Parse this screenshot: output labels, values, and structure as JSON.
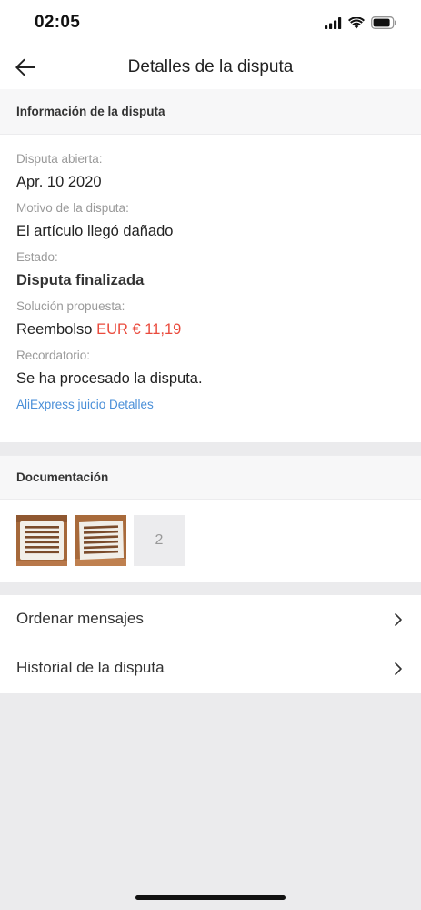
{
  "status": {
    "time": "02:05"
  },
  "header": {
    "title": "Detalles de la disputa"
  },
  "info": {
    "section_title": "Información de la disputa",
    "opened_label": "Disputa abierta:",
    "opened_value": "Apr. 10 2020",
    "reason_label": "Motivo de la disputa:",
    "reason_value": "El artículo llegó dañado",
    "state_label": "Estado:",
    "state_value": "Disputa finalizada",
    "solution_label": "Solución propuesta:",
    "solution_type": "Reembolso",
    "solution_amount": "EUR € 11,19",
    "reminder_label": "Recordatorio:",
    "reminder_value": "Se ha procesado la disputa.",
    "details_link": "AliExpress juicio Detalles"
  },
  "documentation": {
    "section_title": "Documentación",
    "more_count": "2"
  },
  "menu": {
    "items": [
      {
        "label": "Ordenar mensajes"
      },
      {
        "label": "Historial de la disputa"
      }
    ]
  },
  "colors": {
    "accent_price": "#ea4a3c",
    "link": "#4a8fd8"
  },
  "icons": {
    "back": "arrow-left-icon",
    "chevron": "chevron-right-icon",
    "signal": "signal-icon",
    "wifi": "wifi-icon",
    "battery": "battery-icon"
  }
}
